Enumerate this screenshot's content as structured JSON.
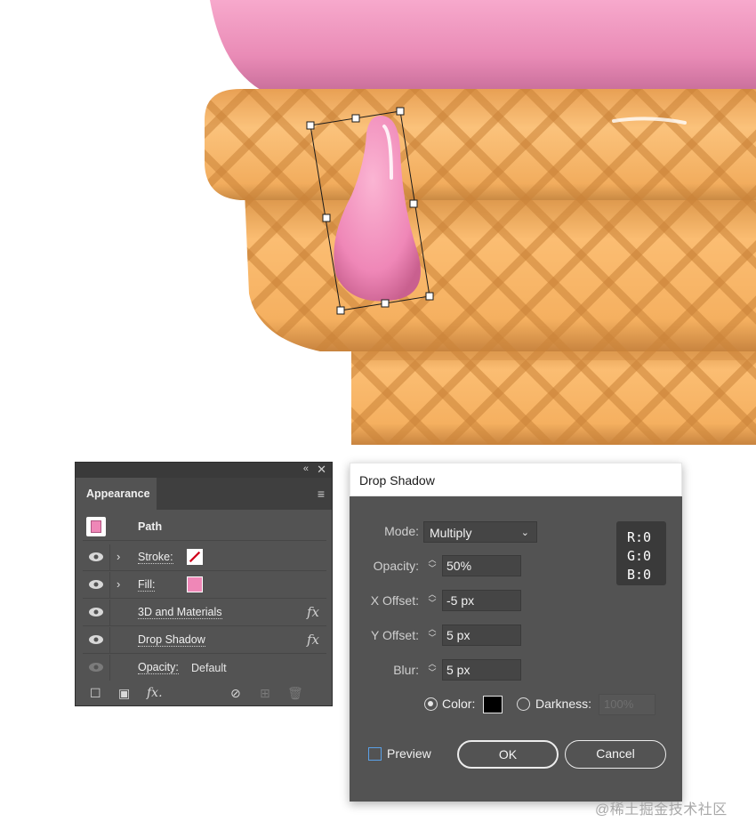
{
  "appearance_panel": {
    "tab_label": "Appearance",
    "rows": [
      {
        "label": "Path"
      },
      {
        "label": "Stroke:"
      },
      {
        "label": "Fill:"
      },
      {
        "label": "3D and Materials"
      },
      {
        "label": "Drop Shadow"
      },
      {
        "label": "Opacity:",
        "value": "Default"
      }
    ]
  },
  "drop_shadow_dialog": {
    "title": "Drop Shadow",
    "mode_label": "Mode:",
    "mode_value": "Multiply",
    "opacity_label": "Opacity:",
    "opacity_value": "50%",
    "x_offset_label": "X Offset:",
    "x_offset_value": "-5 px",
    "y_offset_label": "Y Offset:",
    "y_offset_value": "5 px",
    "blur_label": "Blur:",
    "blur_value": "5 px",
    "rgb": {
      "r": "R:0",
      "g": "G:0",
      "b": "B:0"
    },
    "color_label": "Color:",
    "darkness_label": "Darkness:",
    "darkness_value": "100%",
    "preview_label": "Preview",
    "ok_label": "OK",
    "cancel_label": "Cancel",
    "shadow_color": "#000000"
  },
  "watermark": "@稀土掘金技术社区",
  "colors": {
    "panel_bg": "#535353",
    "fill_pink": "#ef87b7",
    "stroke_none_red": "#d0021b",
    "cone_orange": "#f5b262",
    "ice_cream_pink": "#f08fbb"
  }
}
